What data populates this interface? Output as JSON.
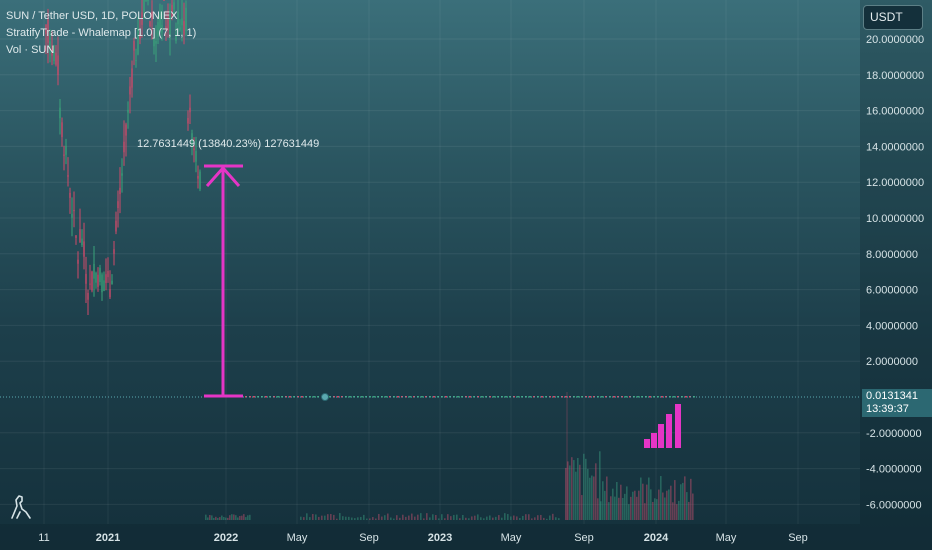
{
  "legend": {
    "symbol_line": "SUN / Tether USD, 1D, POLONIEX",
    "indicator_line": "StratifyTrade - Whalemap [1.0] (7, 1, 1)",
    "volume_line": "Vol · SUN"
  },
  "currency_button": "USDT",
  "price_badge": {
    "price": "0.0131341",
    "countdown": "13:39:37"
  },
  "measurement_label": "12.7631449 (13840.23%) 127631449",
  "colors": {
    "accent_magenta": "#e535c6",
    "candle_up": "#3aa37a",
    "candle_down": "#d04a6a",
    "current_price_line": "#5aa9b0"
  },
  "chart_data": {
    "type": "candlestick",
    "title": "SUN / Tether USD, 1D, POLONIEX",
    "y_axis": {
      "ticks": [
        "20.0000000",
        "18.0000000",
        "16.0000000",
        "14.0000000",
        "12.0000000",
        "10.0000000",
        "8.0000000",
        "6.0000000",
        "4.0000000",
        "2.0000000",
        "-2.0000000",
        "-4.0000000",
        "-6.0000000"
      ],
      "range": [
        -6.8,
        21
      ]
    },
    "x_axis": {
      "ticks": [
        "11",
        "2021",
        "2022",
        "May",
        "Sep",
        "2023",
        "May",
        "Sep",
        "2024",
        "May",
        "Sep"
      ],
      "bold_ticks": [
        "2021",
        "2022",
        "2023",
        "2024"
      ]
    },
    "grid": true,
    "current_price": 0.0131341,
    "measurement": {
      "from_price": 0.0131341,
      "to_price": 12.7631449,
      "change_percent": 13840.23,
      "label": "12.7631449 (13840.23%) 127631449"
    },
    "whalemap_bars": [
      1,
      2,
      3,
      4,
      5
    ],
    "volume": "Vol · SUN"
  }
}
